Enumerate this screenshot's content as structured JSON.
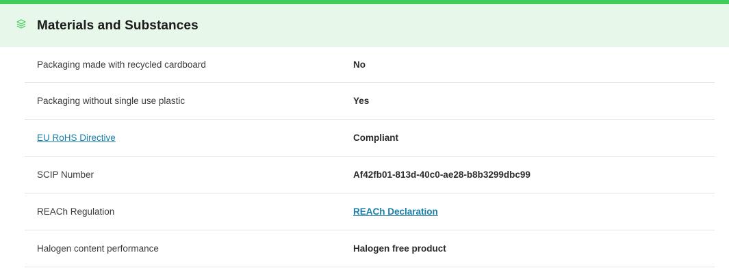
{
  "section": {
    "title": "Materials and Substances",
    "icon": "layers-icon",
    "accent_color": "#3dcd58",
    "header_bg": "#e7f7e9"
  },
  "rows": [
    {
      "label": "Packaging made with recycled cardboard",
      "value": "No"
    },
    {
      "label": "Packaging without single use plastic",
      "value": "Yes"
    },
    {
      "label": "EU RoHS Directive",
      "value": "Compliant"
    },
    {
      "label": "SCIP Number",
      "value": "Af42fb01-813d-40c0-ae28-b8b3299dbc99"
    },
    {
      "label": "REACh Regulation",
      "value": "REACh Declaration"
    },
    {
      "label": "Halogen content performance",
      "value": "Halogen free product"
    }
  ],
  "link_color": "#1a7ea8"
}
